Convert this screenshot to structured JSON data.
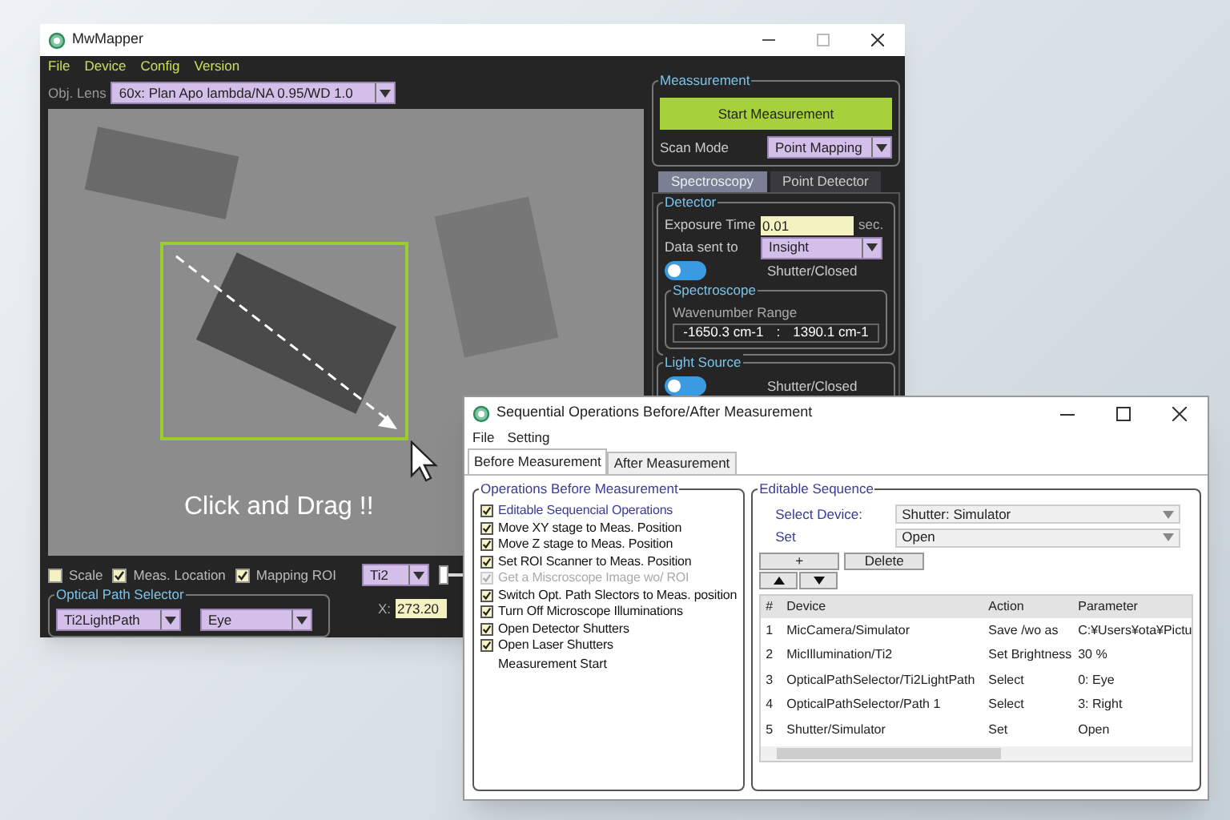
{
  "main_window": {
    "title": "MwMapper",
    "menu": [
      "File",
      "Device",
      "Config",
      "Version"
    ],
    "objective_lens": {
      "label": "Obj. Lens",
      "value": "60x: Plan Apo lambda/NA 0.95/WD 1.0"
    },
    "image_overlay": {
      "hint": "Click and Drag !!"
    },
    "display_options": [
      {
        "label": "Scale",
        "checked": false
      },
      {
        "label": "Meas. Location",
        "checked": true
      },
      {
        "label": "Mapping ROI",
        "checked": true
      }
    ],
    "microscope_select": {
      "value": "Ti2"
    },
    "stage_slider": {
      "level": 0
    },
    "optical_path_selector": {
      "title": "Optical Path Selector",
      "path": "Ti2LightPath",
      "port": "Eye"
    },
    "x_position": {
      "label": "X:",
      "value": "273.20"
    },
    "measurement": {
      "title": "Meassurement",
      "start_button": "Start Measurement",
      "scan_mode_label": "Scan Mode",
      "scan_mode": "Point Mapping"
    },
    "tabs": [
      {
        "label": "Spectroscopy",
        "selected": true
      },
      {
        "label": "Point Detector",
        "selected": false
      }
    ],
    "detector": {
      "title": "Detector",
      "exposure_label": "Exposure Time",
      "exposure_value": "0.01",
      "exposure_unit": "sec.",
      "data_label": "Data sent to",
      "data_value": "Insight",
      "shutter": {
        "label": "Shutter/Closed",
        "on": false
      }
    },
    "spectroscope": {
      "title": "Spectroscope",
      "range_label": "Wavenumber Range",
      "range_min": "-1650.3 cm-1",
      "separator": ":",
      "range_max": "1390.1 cm-1"
    },
    "light_source": {
      "title": "Light Source",
      "shutter": {
        "label": "Shutter/Closed",
        "on": false
      }
    }
  },
  "dialog": {
    "title": "Sequential Operations Before/After Measurement",
    "menu": [
      "File",
      "Setting"
    ],
    "tabs": [
      {
        "label": "Before Measurement",
        "selected": true
      },
      {
        "label": "After Measurement",
        "selected": false
      }
    ],
    "operations": {
      "title": "Operations Before Measurement",
      "items": [
        {
          "kind": "check",
          "label": "Editable Sequencial Operations",
          "checked": true,
          "disabled": false,
          "selected": true
        },
        {
          "kind": "check",
          "label": "Move XY stage to Meas. Position",
          "checked": true,
          "disabled": false,
          "selected": false
        },
        {
          "kind": "check",
          "label": "Move Z stage to Meas. Position",
          "checked": true,
          "disabled": false,
          "selected": false
        },
        {
          "kind": "check",
          "label": "Set ROI Scanner to Meas. Position",
          "checked": true,
          "disabled": false,
          "selected": false
        },
        {
          "kind": "check",
          "label": "Get a Miscroscope Image wo/ ROI",
          "checked": true,
          "disabled": true,
          "selected": false
        },
        {
          "kind": "check",
          "label": "Switch Opt. Path Slectors to Meas. position",
          "checked": true,
          "disabled": false,
          "selected": false
        },
        {
          "kind": "check",
          "label": "Turn  Off Microscope Illuminations",
          "checked": true,
          "disabled": false,
          "selected": false
        },
        {
          "kind": "check",
          "label": "Open Detector Shutters",
          "checked": true,
          "disabled": false,
          "selected": false
        },
        {
          "kind": "check",
          "label": "Open Laser Shutters",
          "checked": true,
          "disabled": false,
          "selected": false
        },
        {
          "kind": "text",
          "label": "Measurement Start"
        }
      ]
    },
    "sequence": {
      "title": "Editable Sequence",
      "device_label": "Select Device:",
      "device_value": "Shutter: Simulator",
      "set_label": "Set",
      "set_value": "Open",
      "add_button": "+",
      "delete_button": "Delete",
      "columns": [
        "#",
        "Device",
        "Action",
        "Parameter"
      ],
      "rows": [
        [
          "1",
          "MicCamera/Simulator",
          "Save  /wo as",
          "C:¥Users¥ota¥Pictu"
        ],
        [
          "2",
          "MicIllumination/Ti2",
          "Set Brightness",
          "30 %"
        ],
        [
          "3",
          "OpticalPathSelector/Ti2LightPath",
          "Select",
          "0: Eye"
        ],
        [
          "4",
          "OpticalPathSelector/Path 1",
          "Select",
          "3: Right"
        ],
        [
          "5",
          "Shutter/Simulator",
          "Set",
          "Open"
        ]
      ]
    }
  }
}
